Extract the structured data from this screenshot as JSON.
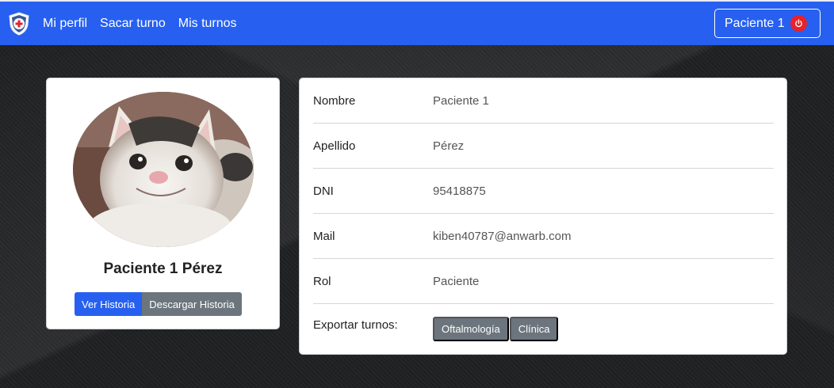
{
  "navbar": {
    "links": [
      "Mi perfil",
      "Sacar turno",
      "Mis turnos"
    ],
    "user_label": "Paciente 1",
    "accent": "#2760f0"
  },
  "profile": {
    "full_name": "Paciente 1 Pérez",
    "buttons": {
      "history": "Ver Historia",
      "download": "Descargar Historia"
    }
  },
  "details": [
    {
      "label": "Nombre",
      "value": "Paciente 1"
    },
    {
      "label": "Apellido",
      "value": "Pérez"
    },
    {
      "label": "DNI",
      "value": "95418875"
    },
    {
      "label": "Mail",
      "value": "kiben40787@anwarb.com"
    },
    {
      "label": "Rol",
      "value": "Paciente"
    }
  ],
  "export": {
    "label": "Exportar turnos:",
    "options": [
      "Oftalmología",
      "Clínica"
    ]
  },
  "icons": {
    "logo": "shield-medical-icon",
    "logout": "power-icon",
    "avatar": "cat-photo"
  }
}
